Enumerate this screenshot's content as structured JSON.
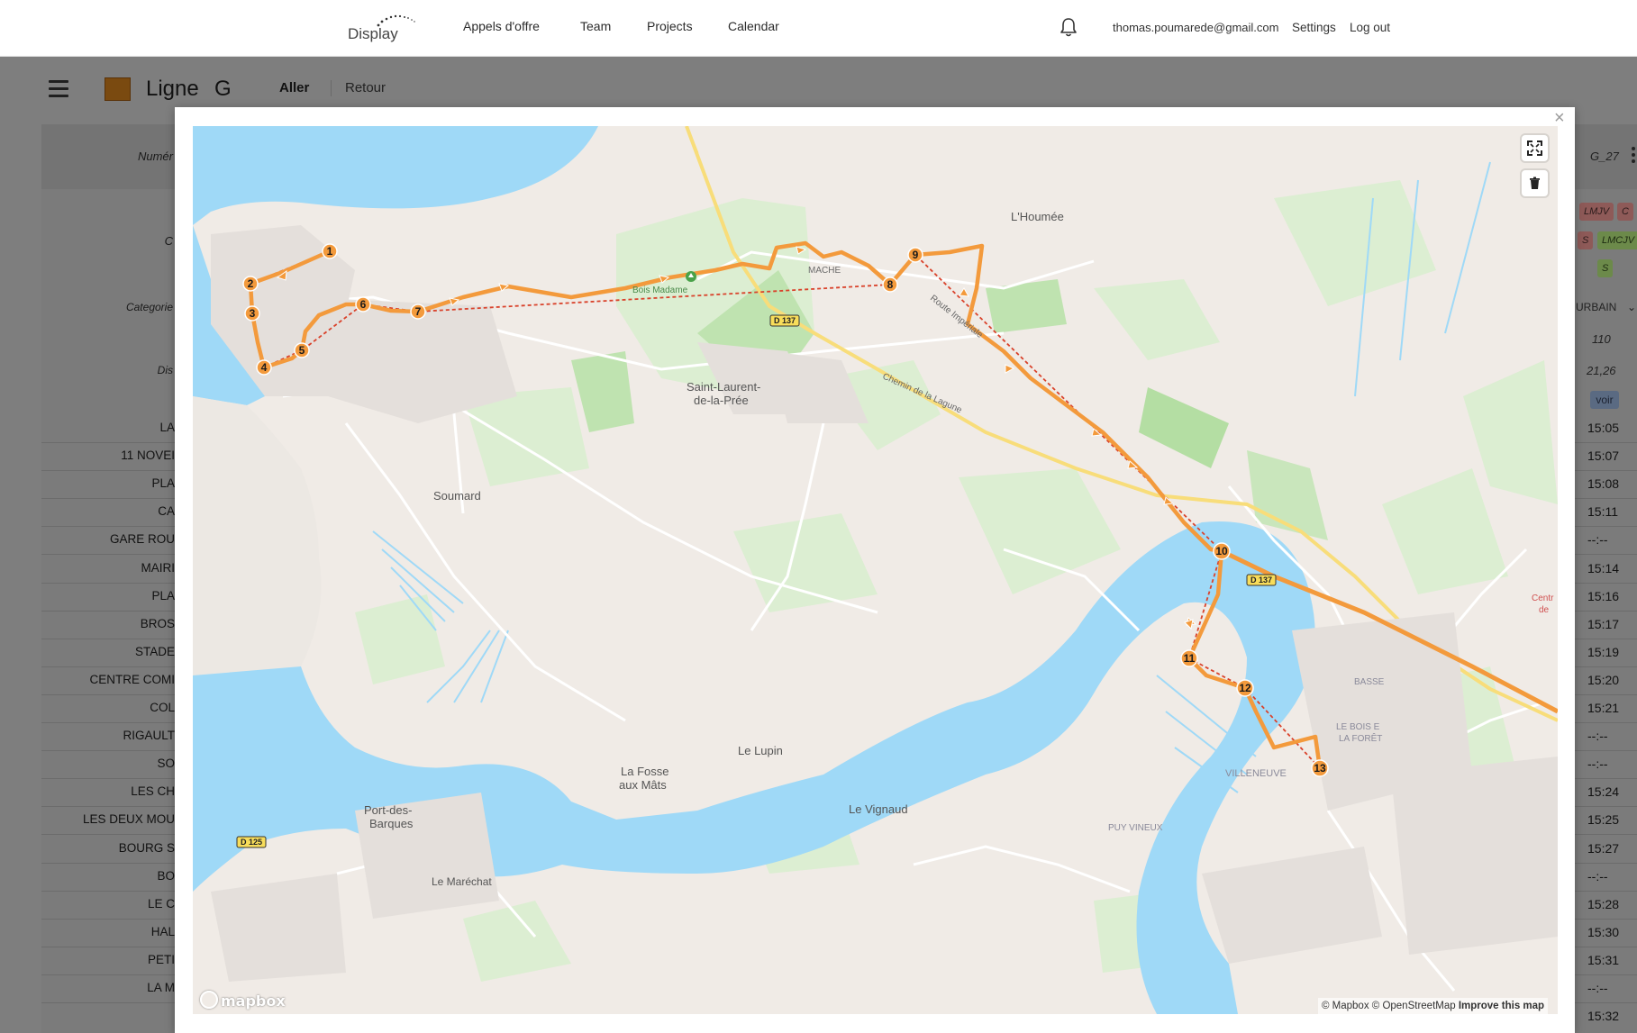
{
  "app": {
    "logo_text": "Display"
  },
  "nav": {
    "links": [
      "Appels d'offre",
      "Team",
      "Projects",
      "Calendar"
    ],
    "email": "thomas.poumarede@gmail.com",
    "settings": "Settings",
    "logout": "Log out"
  },
  "line": {
    "title": "Ligne",
    "letter": "G",
    "color": "#c57a18",
    "tabs": {
      "aller": "Aller",
      "retour": "Retour"
    }
  },
  "table": {
    "left_labels": [
      "Numér",
      "C",
      "Categorie",
      "Dis"
    ],
    "stops": [
      "LA",
      "11 NOVEI",
      "PLA",
      "CA",
      "GARE ROU",
      "MAIRI",
      "PLA",
      "BROS",
      "STADE",
      "CENTRE COMI",
      "COL",
      "RIGAULT",
      "SO",
      "LES CH",
      "LES DEUX MOU",
      "BOURG S",
      "BO",
      "LE C",
      "HAL",
      "PETI",
      "LA M"
    ],
    "times": [
      "15:05",
      "15:07",
      "15:08",
      "15:11",
      "--:--",
      "15:14",
      "15:16",
      "15:17",
      "15:19",
      "15:20",
      "15:21",
      "--:--",
      "--:--",
      "15:24",
      "15:25",
      "15:27",
      "--:--",
      "15:28",
      "15:30",
      "15:31",
      "--:--",
      "15:32"
    ],
    "right_header": "G_27",
    "day_badges": [
      "LMJV",
      "C",
      "S",
      "LMCJV",
      "S"
    ],
    "category_value": "URBAIN",
    "value_1": "110",
    "distance_value": "21,26",
    "voir": "voir"
  },
  "modal": {
    "close": "×"
  },
  "map": {
    "place_labels": {
      "houmee": "L'Houmée",
      "bois_madame": "Bois Madame",
      "mache": "MACHE",
      "saint_laurent_1": "Saint-Laurent-",
      "saint_laurent_2": "de-la-Prée",
      "soumard": "Soumard",
      "route_imperiale": "Route Impériale",
      "chemin_lagune": "Chemin de la Lagune",
      "le_lupin": "Le Lupin",
      "la_fosse_1": "La Fosse",
      "la_fosse_2": "aux Mâts",
      "le_vignaud": "Le Vignaud",
      "port_des_barques_1": "Port-des-",
      "port_des_barques_2": "Barques",
      "le_marechat": "Le Maréchat",
      "villeneuve": "VILLENEUVE",
      "puy_vineux": "PUY VINEUX",
      "basse": "BASSE",
      "bois_foret_1": "LE BOIS E",
      "bois_foret_2": "LA FORÊT",
      "centre_1": "Centr",
      "centre_2": "de"
    },
    "road_shields": [
      "D 137",
      "D 137",
      "D 125"
    ],
    "stop_numbers": [
      "1",
      "2",
      "3",
      "4",
      "5",
      "6",
      "7",
      "8",
      "9",
      "10",
      "11",
      "12",
      "13"
    ],
    "route_color": "#f39a3c",
    "water_color": "#9fd9f7",
    "fullscreen_icon": "fullscreen-icon",
    "trash_icon": "trash-icon",
    "mapbox_logo": "mapbox",
    "attribution": "© Mapbox © OpenStreetMap",
    "improve": "Improve this map"
  }
}
